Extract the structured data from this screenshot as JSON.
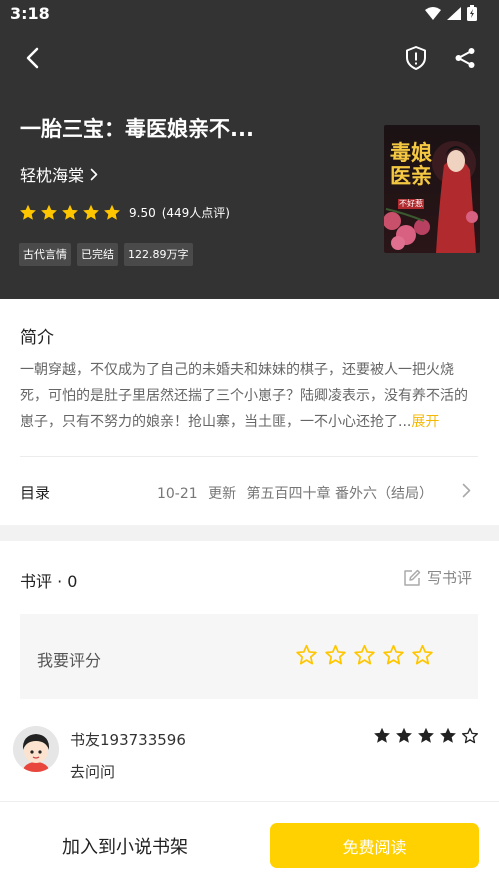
{
  "status_bar": {
    "time": "3:18"
  },
  "book": {
    "title": "一胎三宝：毒医娘亲不...",
    "author": "轻枕海棠",
    "rating": {
      "stars": 5,
      "max_stars": 5,
      "score": "9.50",
      "count_text": "(449人点评)"
    },
    "tags": [
      "古代言情",
      "已完结",
      "122.89万字"
    ],
    "cover": {
      "title_text": "毒娘医亲",
      "subtitle_text": "不好惹"
    }
  },
  "intro": {
    "heading": "简介",
    "text": "一朝穿越，不仅成为了自己的未婚夫和妹妹的棋子，还要被人一把火烧死，可怕的是肚子里居然还揣了三个小崽子？陆卿凌表示，没有养不活的崽子，只有不努力的娘亲！抢山寨，当土匪，一不小心还抢了...",
    "expand_label": "展开"
  },
  "toc": {
    "label": "目录",
    "date": "10-21",
    "update": "更新",
    "latest_chapter": "第五百四十章 番外六（结局）"
  },
  "reviews": {
    "heading": "书评 · 0",
    "write_label": "写书评",
    "rate_prompt": "我要评分",
    "rate_stars": 5,
    "items": [
      {
        "user": "书友193733596",
        "stars": 4,
        "max_stars": 5,
        "text": "去问问"
      }
    ]
  },
  "bottom": {
    "add_shelf_label": "加入到小说书架",
    "read_label": "免费阅读"
  },
  "colors": {
    "header_bg": "#333333",
    "accent": "#ffd100",
    "star_gold": "#ffc600",
    "expand_link": "#f5b800"
  },
  "icons": {
    "back": "back-arrow-icon",
    "report": "shield-exclamation-icon",
    "share": "share-icon",
    "author_chevron": "chevron-right-icon",
    "write": "edit-icon"
  }
}
